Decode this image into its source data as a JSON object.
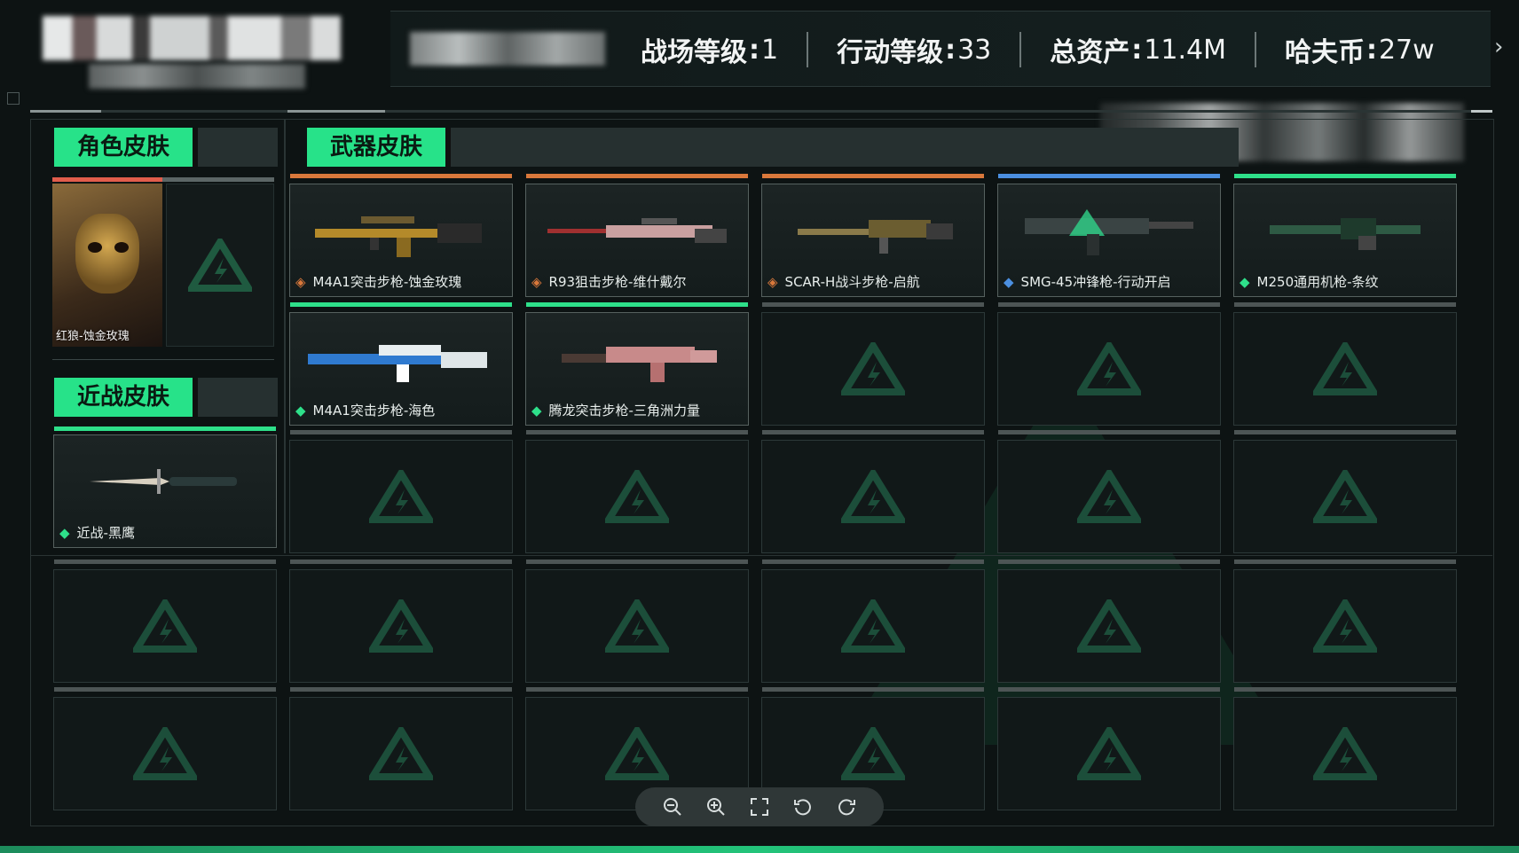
{
  "header": {
    "stats": [
      {
        "label": "战场等级",
        "value": "1"
      },
      {
        "label": "行动等级",
        "value": "33"
      },
      {
        "label": "总资产",
        "value": "11.4M"
      },
      {
        "label": "哈夫币",
        "value": "27w"
      }
    ]
  },
  "sections": {
    "character": "角色皮肤",
    "weapon": "武器皮肤",
    "melee": "近战皮肤"
  },
  "character_skin": {
    "name": "红狼-蚀金玫瑰",
    "rarity_color": "#e15d4c"
  },
  "weapon_skins": [
    {
      "name": "M4A1突击步枪-蚀金玫瑰",
      "rarity": "orange",
      "rarity_color": "#d9783b",
      "rarity_icon": "orange-diamond-icon"
    },
    {
      "name": "R93狙击步枪-维什戴尔",
      "rarity": "orange",
      "rarity_color": "#d9783b",
      "rarity_icon": "orange-diamond-icon"
    },
    {
      "name": "SCAR-H战斗步枪-启航",
      "rarity": "orange",
      "rarity_color": "#d9783b",
      "rarity_icon": "orange-diamond-icon"
    },
    {
      "name": "SMG-45冲锋枪-行动开启",
      "rarity": "blue",
      "rarity_color": "#4b8fe0",
      "rarity_icon": "blue-diamond-icon"
    },
    {
      "name": "M250通用机枪-条纹",
      "rarity": "green",
      "rarity_color": "#2ee08a",
      "rarity_icon": "green-diamond-icon"
    },
    {
      "name": "M4A1突击步枪-海色",
      "rarity": "green",
      "rarity_color": "#2ee08a",
      "rarity_icon": "green-diamond-icon"
    },
    {
      "name": "腾龙突击步枪-三角洲力量",
      "rarity": "green",
      "rarity_color": "#2ee08a",
      "rarity_icon": "green-diamond-icon"
    }
  ],
  "melee_skin": {
    "name": "近战-黑鹰",
    "rarity_color": "#2ee08a",
    "rarity_icon": "green-diamond-icon"
  },
  "toolbar": [
    "zoom-out-icon",
    "zoom-in-icon",
    "fullscreen-icon",
    "rotate-left-icon",
    "rotate-right-icon"
  ],
  "colors": {
    "accent": "#27e289",
    "background": "#0d1313"
  }
}
